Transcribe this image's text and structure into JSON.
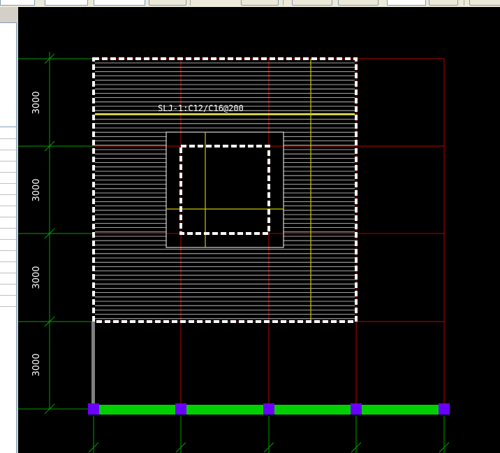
{
  "dimensions": {
    "row_1": "3000",
    "row_2": "3000",
    "row_3": "3000",
    "row_4": "3000"
  },
  "slab_label": "SLJ-1:C12/C16@200",
  "colors": {
    "background": "#000000",
    "grid_red": "#c00000",
    "dimension_green": "#00a000",
    "rebar_white": "#ffffff",
    "rebar_yellow": "#e0e000",
    "beam_green": "#00e000",
    "column_purple": "#6600ff",
    "wall_gray": "#808080"
  }
}
